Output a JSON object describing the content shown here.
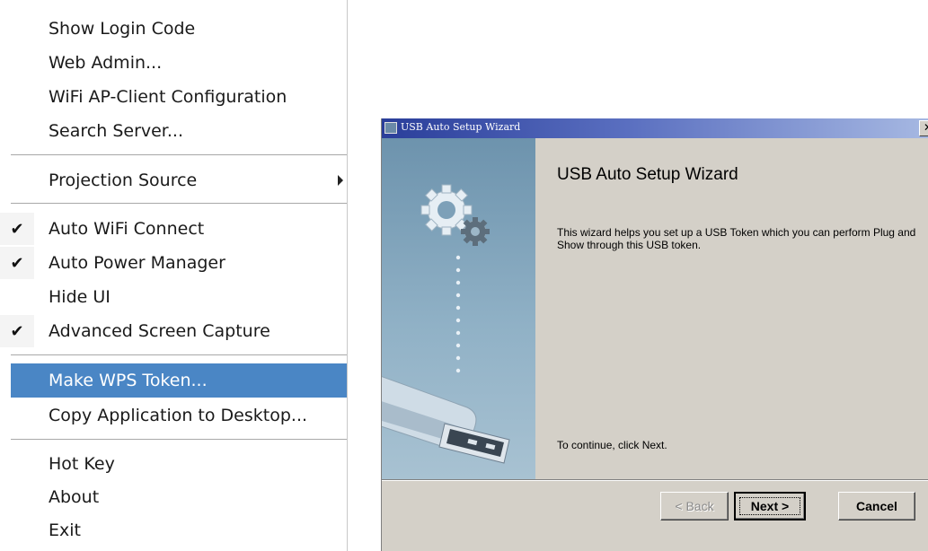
{
  "context_menu": {
    "items": [
      {
        "label": "Show Login Code"
      },
      {
        "label": "Web Admin..."
      },
      {
        "label": "WiFi AP-Client Configuration"
      },
      {
        "label": "Search Server..."
      },
      {
        "label": "Projection Source"
      },
      {
        "label": "Auto WiFi Connect",
        "checked": true
      },
      {
        "label": "Auto Power Manager",
        "checked": true
      },
      {
        "label": "Hide UI"
      },
      {
        "label": "Advanced Screen Capture",
        "checked": true
      },
      {
        "label": "Make WPS Token...",
        "highlighted": true
      },
      {
        "label": "Copy Application to Desktop..."
      },
      {
        "label": "Hot Key"
      },
      {
        "label": "About"
      },
      {
        "label": "Exit"
      }
    ],
    "check_glyph": "✔"
  },
  "wizard": {
    "window_title": "USB Auto Setup Wizard",
    "close_glyph": "✕",
    "heading": "USB Auto Setup Wizard",
    "description": "This wizard helps you set up a USB Token which you can perform Plug and Show through this USB token.",
    "footer_hint": "To continue, click Next.",
    "buttons": {
      "back": "< Back",
      "next": "Next >",
      "cancel": "Cancel"
    },
    "side_panel_icons": [
      "gears-icon",
      "usb-drive-icon"
    ]
  },
  "colors": {
    "menu_highlight": "#4a86c5",
    "titlebar_start": "#2a3e9a",
    "titlebar_end": "#a6b8e2",
    "dialog_bg": "#d4d0c8",
    "side_panel": "#7fa2ba"
  }
}
